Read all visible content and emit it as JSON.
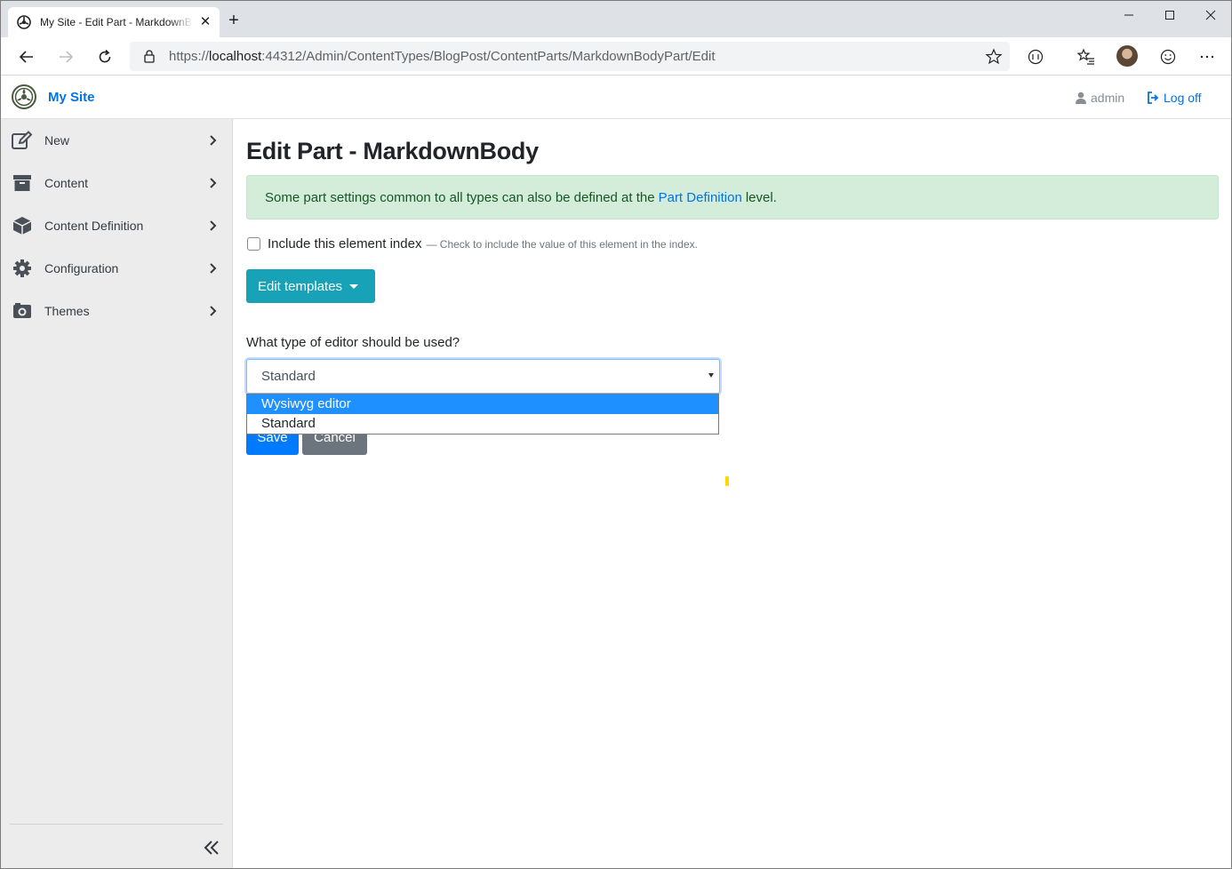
{
  "browser": {
    "tab_title": "My Site - Edit Part - MarkdownBody",
    "url_prefix": "https://",
    "url_host": "localhost",
    "url_rest": ":44312/Admin/ContentTypes/BlogPost/ContentParts/MarkdownBodyPart/Edit"
  },
  "navbar": {
    "brand": "My Site",
    "user": "admin",
    "logoff": "Log off"
  },
  "sidebar": {
    "items": [
      {
        "label": "New",
        "icon": "edit-icon"
      },
      {
        "label": "Content",
        "icon": "archive-icon"
      },
      {
        "label": "Content Definition",
        "icon": "cube-icon"
      },
      {
        "label": "Configuration",
        "icon": "gear-icon"
      },
      {
        "label": "Themes",
        "icon": "camera-icon"
      }
    ]
  },
  "main": {
    "title": "Edit Part - MarkdownBody",
    "alert_prefix": "Some part settings common to all types can also be defined at the",
    "alert_link": "Part Definition",
    "alert_suffix": "level.",
    "checkbox_label": "Include this element index",
    "checkbox_hint": "— Check to include the value of this element in the index.",
    "edit_templates": "Edit templates",
    "editor_question": "What type of editor should be used?",
    "editor_selected": "Standard",
    "editor_options": [
      "Wysiwyg editor",
      "Standard"
    ],
    "save": "Save",
    "cancel": "Cancel"
  },
  "colors": {
    "accent": "#0073e6",
    "info_button": "#17a2b8",
    "primary_button": "#007bff",
    "secondary_button": "#6c757d",
    "alert_bg": "#d4edda",
    "option_highlight": "#1e90ff"
  }
}
